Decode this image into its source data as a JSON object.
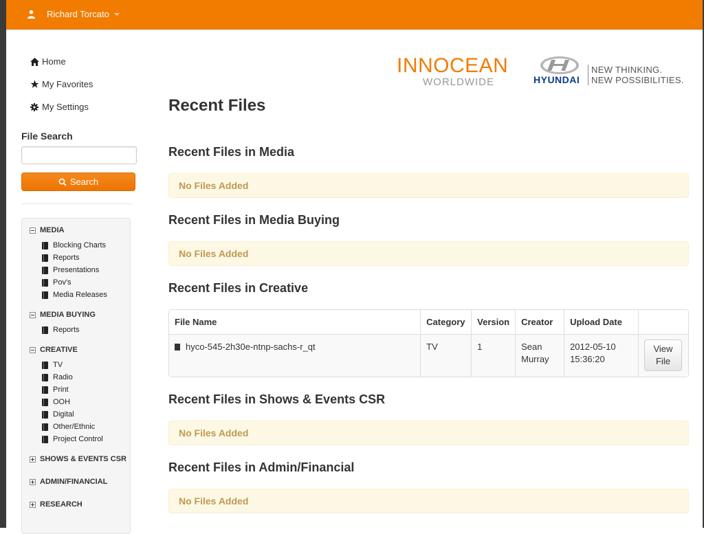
{
  "topbar": {
    "user_name": "Richard Torcato",
    "brand_color": "#f27c00"
  },
  "nav": {
    "home": "Home",
    "favorites": "My Favorites",
    "settings": "My Settings"
  },
  "search": {
    "label": "File Search",
    "value": "",
    "placeholder": "",
    "button": "Search"
  },
  "tree": {
    "categories": [
      {
        "label": "MEDIA",
        "expanded": true,
        "items": [
          "Blocking Charts",
          "Reports",
          "Presentations",
          "Pov's",
          "Media Releases"
        ]
      },
      {
        "label": "MEDIA BUYING",
        "expanded": true,
        "items": [
          "Reports"
        ]
      },
      {
        "label": "CREATIVE",
        "expanded": true,
        "items": [
          "TV",
          "Radio",
          "Print",
          "OOH",
          "Digital",
          "Other/Ethnic",
          "Project Control"
        ]
      },
      {
        "label": "SHOWS & EVENTS CSR",
        "expanded": false,
        "items": []
      },
      {
        "label": "ADMIN/FINANCIAL",
        "expanded": false,
        "items": []
      },
      {
        "label": "RESEARCH",
        "expanded": false,
        "items": []
      }
    ]
  },
  "logos": {
    "innocean_main": "INNOCEAN",
    "innocean_sub": "WORLDWIDE",
    "hyundai_word": "HYUNDAI",
    "hyundai_tag1": "NEW THINKING.",
    "hyundai_tag2": "NEW POSSIBILITIES."
  },
  "main": {
    "title": "Recent Files",
    "sections": [
      {
        "title": "Recent Files in Media",
        "empty_text": "No Files Added"
      },
      {
        "title": "Recent Files in Media Buying",
        "empty_text": "No Files Added"
      },
      {
        "title": "Recent Files in Creative"
      },
      {
        "title": "Recent Files in Shows & Events CSR",
        "empty_text": "No Files Added"
      },
      {
        "title": "Recent Files in Admin/Financial",
        "empty_text": "No Files Added"
      }
    ],
    "table": {
      "headers": [
        "File Name",
        "Category",
        "Version",
        "Creator",
        "Upload Date",
        ""
      ],
      "rows": [
        {
          "file_name": "hyco-545-2h30e-ntnp-sachs-r_qt",
          "category": "TV",
          "version": "1",
          "creator_line1": "Sean",
          "creator_line2": "Murray",
          "date_line1": "2012-05-10",
          "date_line2": "15:36:20",
          "view_line1": "View",
          "view_line2": "File"
        }
      ]
    }
  }
}
